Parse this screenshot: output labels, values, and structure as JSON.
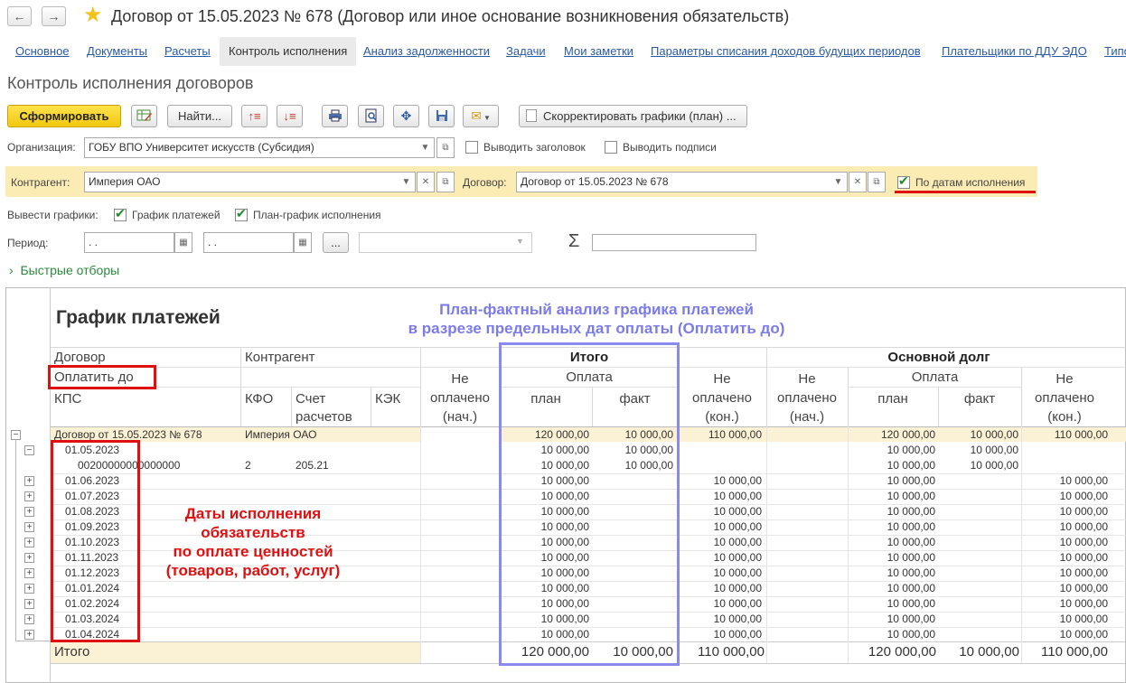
{
  "window": {
    "title": "Договор от 15.05.2023 № 678 (Договор или иное основание возникновения обязательств)",
    "back_icon": "←",
    "forward_icon": "→"
  },
  "tabs": [
    {
      "label": "Основное"
    },
    {
      "label": "Документы"
    },
    {
      "label": "Расчеты"
    },
    {
      "label": "Контроль исполнения"
    },
    {
      "label": "Анализ задолженности"
    },
    {
      "label": "Задачи"
    },
    {
      "label": "Мои заметки"
    },
    {
      "label": "Параметры списания доходов будущих периодов"
    },
    {
      "label": "Плательщики по ДДУ ЭДО"
    },
    {
      "label": "Типо"
    }
  ],
  "page_title": "Контроль исполнения договоров",
  "toolbar": {
    "generate": "Сформировать",
    "find": "Найти...",
    "correct_schedules": "Скорректировать графики (план) ..."
  },
  "filters": {
    "org_label": "Организация:",
    "org_value": "ГОБУ ВПО Университет искусств (Субсидия)",
    "show_header": "Выводить заголовок",
    "show_signatures": "Выводить подписи",
    "counterparty_label": "Контрагент:",
    "counterparty_value": "Империя ОАО",
    "contract_label": "Договор:",
    "contract_value": "Договор от 15.05.2023 № 678",
    "by_dates": "По датам исполнения",
    "show_graphs_label": "Вывести графики:",
    "payment_schedule": "График платежей",
    "plan_schedule": "План-график исполнения",
    "period_label": "Период:",
    "period_from": " .  .",
    "period_to": " .  .",
    "ellipsis": "...",
    "sigma": "Σ",
    "quick_filters": "Быстрые отборы"
  },
  "report": {
    "title": "График платежей",
    "annotation_top_1": "План-фактный анализ графика платежей",
    "annotation_top_2": "в разрезе предельных дат оплаты (Оплатить до)",
    "annotation_left_1": "Даты исполнения",
    "annotation_left_2": "обязательств",
    "annotation_left_3": "по оплате ценностей",
    "annotation_left_4": "(товаров, работ, услуг)",
    "headers": {
      "contract": "Договор",
      "counterparty": "Контрагент",
      "pay_by": "Оплатить до",
      "kps": "КПС",
      "kfo": "КФО",
      "account1": "Счет",
      "account2": "расчетов",
      "kek": "КЭК",
      "total": "Итого",
      "main_debt": "Основной долг",
      "payment": "Оплата",
      "payment2": "Оплата",
      "unpaid_start": [
        "Не",
        "оплачено",
        "(нач.)"
      ],
      "unpaid_end": [
        "Не",
        "оплачено",
        "(кон.)"
      ],
      "plan": "план",
      "fact": "факт"
    },
    "contract_row": {
      "label": "Договор от 15.05.2023 № 678",
      "counterparty": "Империя ОАО",
      "plan": "120 000,00",
      "fact": "10 000,00",
      "unpaid_end": "110 000,00",
      "md_plan": "120 000,00",
      "md_fact": "10 000,00",
      "md_unpaid_end": "110 000,00"
    },
    "first_date_row": {
      "label": "01.05.2023",
      "plan": "10 000,00",
      "fact": "10 000,00",
      "md_plan": "10 000,00",
      "md_fact": "10 000,00"
    },
    "kps_row": {
      "kps": "00200000000000000",
      "kfo": "2",
      "account": "205.21",
      "plan": "10 000,00",
      "fact": "10 000,00",
      "md_plan": "10 000,00",
      "md_fact": "10 000,00"
    },
    "date_rows": [
      {
        "date": "01.06.2023",
        "plan": "10 000,00",
        "unpaid": "10 000,00",
        "md_plan": "10 000,00",
        "md_unpaid": "10 000,00"
      },
      {
        "date": "01.07.2023",
        "plan": "10 000,00",
        "unpaid": "10 000,00",
        "md_plan": "10 000,00",
        "md_unpaid": "10 000,00"
      },
      {
        "date": "01.08.2023",
        "plan": "10 000,00",
        "unpaid": "10 000,00",
        "md_plan": "10 000,00",
        "md_unpaid": "10 000,00"
      },
      {
        "date": "01.09.2023",
        "plan": "10 000,00",
        "unpaid": "10 000,00",
        "md_plan": "10 000,00",
        "md_unpaid": "10 000,00"
      },
      {
        "date": "01.10.2023",
        "plan": "10 000,00",
        "unpaid": "10 000,00",
        "md_plan": "10 000,00",
        "md_unpaid": "10 000,00"
      },
      {
        "date": "01.11.2023",
        "plan": "10 000,00",
        "unpaid": "10 000,00",
        "md_plan": "10 000,00",
        "md_unpaid": "10 000,00"
      },
      {
        "date": "01.12.2023",
        "plan": "10 000,00",
        "unpaid": "10 000,00",
        "md_plan": "10 000,00",
        "md_unpaid": "10 000,00"
      },
      {
        "date": "01.01.2024",
        "plan": "10 000,00",
        "unpaid": "10 000,00",
        "md_plan": "10 000,00",
        "md_unpaid": "10 000,00"
      },
      {
        "date": "01.02.2024",
        "plan": "10 000,00",
        "unpaid": "10 000,00",
        "md_plan": "10 000,00",
        "md_unpaid": "10 000,00"
      },
      {
        "date": "01.03.2024",
        "plan": "10 000,00",
        "unpaid": "10 000,00",
        "md_plan": "10 000,00",
        "md_unpaid": "10 000,00"
      },
      {
        "date": "01.04.2024",
        "plan": "10 000,00",
        "unpaid": "10 000,00",
        "md_plan": "10 000,00",
        "md_unpaid": "10 000,00"
      }
    ],
    "total_row": {
      "label": "Итого",
      "plan": "120 000,00",
      "fact": "10 000,00",
      "unpaid_end": "110 000,00",
      "md_plan": "120 000,00",
      "md_fact": "10 000,00",
      "md_unpaid_end": "110 000,00"
    }
  },
  "colors": {
    "accent_yellow": "#f1c80f",
    "annotation_blue": "#7b7bea",
    "annotation_red": "#e01010",
    "link": "#2a5aa8"
  }
}
